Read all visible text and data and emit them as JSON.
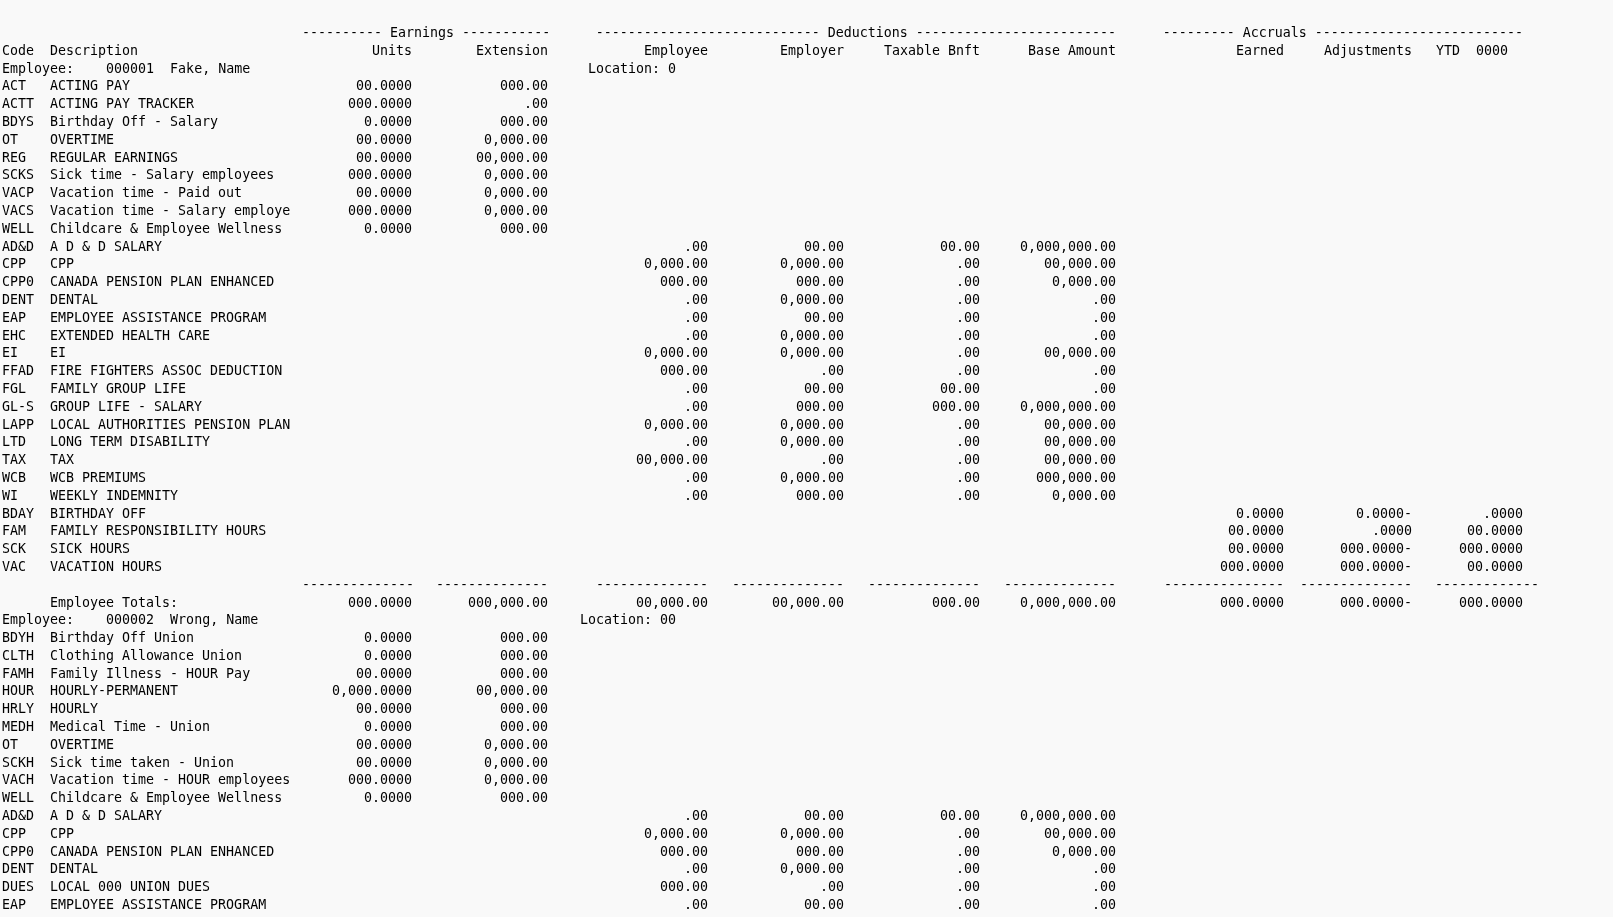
{
  "group_headers": {
    "earnings": "---------- Earnings -----------",
    "deductions": "---------------------------- Deductions -------------------------",
    "accruals": "--------- Accruals --------------------------"
  },
  "column_headers": {
    "code": "Code",
    "description": "Description",
    "units": "Units",
    "extension": "Extension",
    "employee": "Employee",
    "employer": "Employer",
    "taxable_bnft": "Taxable Bnft",
    "base_amount": "Base Amount",
    "earned": "Earned",
    "adjustments": "Adjustments",
    "ytd": "YTD  0000"
  },
  "employees": [
    {
      "employee_line": "Employee:    000001  Fake, Name",
      "location": "Location: 0",
      "rows": [
        {
          "code": "ACT",
          "description": "ACTING PAY",
          "units": "00.0000",
          "extension": "000.00"
        },
        {
          "code": "ACTT",
          "description": "ACTING PAY TRACKER",
          "units": "000.0000",
          "extension": ".00"
        },
        {
          "code": "BDYS",
          "description": "Birthday Off - Salary",
          "units": "0.0000",
          "extension": "000.00"
        },
        {
          "code": "OT",
          "description": "OVERTIME",
          "units": "00.0000",
          "extension": "0,000.00"
        },
        {
          "code": "REG",
          "description": "REGULAR EARNINGS",
          "units": "00.0000",
          "extension": "00,000.00"
        },
        {
          "code": "SCKS",
          "description": "Sick time - Salary employees",
          "units": "000.0000",
          "extension": "0,000.00"
        },
        {
          "code": "VACP",
          "description": "Vacation time - Paid out",
          "units": "00.0000",
          "extension": "0,000.00"
        },
        {
          "code": "VACS",
          "description": "Vacation time - Salary employe",
          "units": "000.0000",
          "extension": "0,000.00"
        },
        {
          "code": "WELL",
          "description": "Childcare & Employee Wellness",
          "units": "0.0000",
          "extension": "000.00"
        },
        {
          "code": "AD&D",
          "description": "A D & D SALARY",
          "employee": ".00",
          "employer": "00.00",
          "taxable_bnft": "00.00",
          "base_amount": "0,000,000.00"
        },
        {
          "code": "CPP",
          "description": "CPP",
          "employee": "0,000.00",
          "employer": "0,000.00",
          "taxable_bnft": ".00",
          "base_amount": "00,000.00"
        },
        {
          "code": "CPP0",
          "description": "CANADA PENSION PLAN ENHANCED",
          "employee": "000.00",
          "employer": "000.00",
          "taxable_bnft": ".00",
          "base_amount": "0,000.00"
        },
        {
          "code": "DENT",
          "description": "DENTAL",
          "employee": ".00",
          "employer": "0,000.00",
          "taxable_bnft": ".00",
          "base_amount": ".00"
        },
        {
          "code": "EAP",
          "description": "EMPLOYEE ASSISTANCE PROGRAM",
          "employee": ".00",
          "employer": "00.00",
          "taxable_bnft": ".00",
          "base_amount": ".00"
        },
        {
          "code": "EHC",
          "description": "EXTENDED HEALTH CARE",
          "employee": ".00",
          "employer": "0,000.00",
          "taxable_bnft": ".00",
          "base_amount": ".00"
        },
        {
          "code": "EI",
          "description": "EI",
          "employee": "0,000.00",
          "employer": "0,000.00",
          "taxable_bnft": ".00",
          "base_amount": "00,000.00"
        },
        {
          "code": "FFAD",
          "description": "FIRE FIGHTERS ASSOC DEDUCTION",
          "employee": "000.00",
          "employer": ".00",
          "taxable_bnft": ".00",
          "base_amount": ".00"
        },
        {
          "code": "FGL",
          "description": "FAMILY GROUP LIFE",
          "employee": ".00",
          "employer": "00.00",
          "taxable_bnft": "00.00",
          "base_amount": ".00"
        },
        {
          "code": "GL-S",
          "description": "GROUP LIFE - SALARY",
          "employee": ".00",
          "employer": "000.00",
          "taxable_bnft": "000.00",
          "base_amount": "0,000,000.00"
        },
        {
          "code": "LAPP",
          "description": "LOCAL AUTHORITIES PENSION PLAN",
          "employee": "0,000.00",
          "employer": "0,000.00",
          "taxable_bnft": ".00",
          "base_amount": "00,000.00"
        },
        {
          "code": "LTD",
          "description": "LONG TERM DISABILITY",
          "employee": ".00",
          "employer": "0,000.00",
          "taxable_bnft": ".00",
          "base_amount": "00,000.00"
        },
        {
          "code": "TAX",
          "description": "TAX",
          "employee": "00,000.00",
          "employer": ".00",
          "taxable_bnft": ".00",
          "base_amount": "00,000.00"
        },
        {
          "code": "WCB",
          "description": "WCB PREMIUMS",
          "employee": ".00",
          "employer": "0,000.00",
          "taxable_bnft": ".00",
          "base_amount": "000,000.00"
        },
        {
          "code": "WI",
          "description": "WEEKLY INDEMNITY",
          "employee": ".00",
          "employer": "000.00",
          "taxable_bnft": ".00",
          "base_amount": "0,000.00"
        },
        {
          "code": "BDAY",
          "description": "BIRTHDAY OFF",
          "earned": "0.0000",
          "adjustments": "0.0000-",
          "ytd": ".0000"
        },
        {
          "code": "FAM",
          "description": "FAMILY RESPONSIBILITY HOURS",
          "earned": "00.0000",
          "adjustments": ".0000",
          "ytd": "00.0000"
        },
        {
          "code": "SCK",
          "description": "SICK HOURS",
          "earned": "00.0000",
          "adjustments": "000.0000-",
          "ytd": "000.0000"
        },
        {
          "code": "VAC",
          "description": "VACATION HOURS",
          "earned": "000.0000",
          "adjustments": "000.0000-",
          "ytd": "00.0000"
        }
      ],
      "separators": {
        "units": "--------------",
        "extension": "--------------",
        "employee": "--------------",
        "employer": "--------------",
        "taxable_bnft": "--------------",
        "base_amount": "--------------",
        "earned": "---------------",
        "adjustments": "--------------",
        "ytd": "-------------"
      },
      "totals": {
        "description": "Employee Totals:",
        "units": "000.0000",
        "extension": "000,000.00",
        "employee": "00,000.00",
        "employer": "00,000.00",
        "taxable_bnft": "000.00",
        "base_amount": "0,000,000.00",
        "earned": "000.0000",
        "adjustments": "000.0000-",
        "ytd": "000.0000"
      }
    },
    {
      "employee_line": "Employee:    000002  Wrong, Name",
      "location": "Location: 00",
      "rows": [
        {
          "code": "BDYH",
          "description": "Birthday Off Union",
          "units": "0.0000",
          "extension": "000.00"
        },
        {
          "code": "CLTH",
          "description": "Clothing Allowance Union",
          "units": "0.0000",
          "extension": "000.00"
        },
        {
          "code": "FAMH",
          "description": "Family Illness - HOUR Pay",
          "units": "00.0000",
          "extension": "000.00"
        },
        {
          "code": "HOUR",
          "description": "HOURLY-PERMANENT",
          "units": "0,000.0000",
          "extension": "00,000.00"
        },
        {
          "code": "HRLY",
          "description": "HOURLY",
          "units": "00.0000",
          "extension": "000.00"
        },
        {
          "code": "MEDH",
          "description": "Medical Time - Union",
          "units": "0.0000",
          "extension": "000.00"
        },
        {
          "code": "OT",
          "description": "OVERTIME",
          "units": "00.0000",
          "extension": "0,000.00"
        },
        {
          "code": "SCKH",
          "description": "Sick time taken - Union",
          "units": "00.0000",
          "extension": "0,000.00"
        },
        {
          "code": "VACH",
          "description": "Vacation time - HOUR employees",
          "units": "000.0000",
          "extension": "0,000.00"
        },
        {
          "code": "WELL",
          "description": "Childcare & Employee Wellness",
          "units": "0.0000",
          "extension": "000.00"
        },
        {
          "code": "AD&D",
          "description": "A D & D SALARY",
          "employee": ".00",
          "employer": "00.00",
          "taxable_bnft": "00.00",
          "base_amount": "0,000,000.00"
        },
        {
          "code": "CPP",
          "description": "CPP",
          "employee": "0,000.00",
          "employer": "0,000.00",
          "taxable_bnft": ".00",
          "base_amount": "00,000.00"
        },
        {
          "code": "CPP0",
          "description": "CANADA PENSION PLAN ENHANCED",
          "employee": "000.00",
          "employer": "000.00",
          "taxable_bnft": ".00",
          "base_amount": "0,000.00"
        },
        {
          "code": "DENT",
          "description": "DENTAL",
          "employee": ".00",
          "employer": "0,000.00",
          "taxable_bnft": ".00",
          "base_amount": ".00"
        },
        {
          "code": "DUES",
          "description": "LOCAL 000 UNION DUES",
          "employee": "000.00",
          "employer": ".00",
          "taxable_bnft": ".00",
          "base_amount": ".00"
        },
        {
          "code": "EAP",
          "description": "EMPLOYEE ASSISTANCE PROGRAM",
          "employee": ".00",
          "employer": "00.00",
          "taxable_bnft": ".00",
          "base_amount": ".00"
        }
      ]
    }
  ]
}
